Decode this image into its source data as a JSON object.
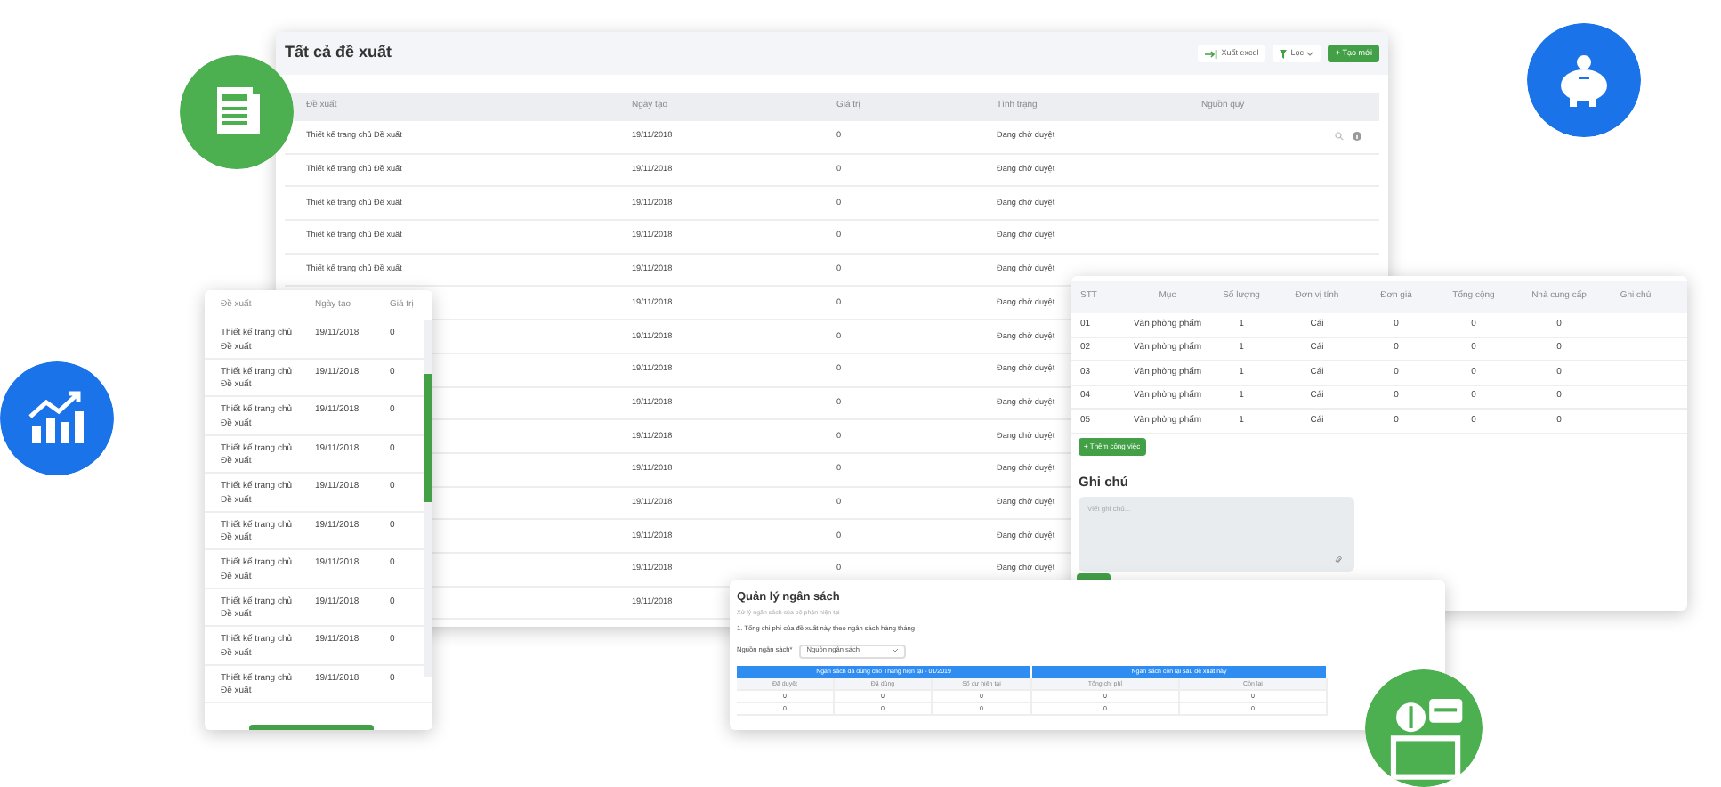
{
  "main_panel": {
    "title": "Tất cả đề xuất",
    "buttons": [
      {
        "kind": "export",
        "label": "Xuất excel"
      },
      {
        "kind": "filter",
        "label": "Lọc"
      },
      {
        "kind": "create",
        "label": "+ Tạo mới"
      }
    ],
    "columns": [
      "Đề xuất",
      "Ngày tạo",
      "Giá trị",
      "Tình trạng",
      "Nguồn quỹ"
    ],
    "rows": [
      {
        "title": "Thiết kế trang chủ Đề xuất",
        "date": "19/11/2018",
        "value": "0",
        "status": "Đang chờ duyệt",
        "actions": true
      },
      {
        "title": "Thiết kế trang chủ Đề xuất",
        "date": "19/11/2018",
        "value": "0",
        "status": "Đang chờ duyệt",
        "actions": false
      },
      {
        "title": "Thiết kế trang chủ Đề xuất",
        "date": "19/11/2018",
        "value": "0",
        "status": "Đang chờ duyệt",
        "actions": false
      },
      {
        "title": "Thiết kế trang chủ Đề xuất",
        "date": "19/11/2018",
        "value": "0",
        "status": "Đang chờ duyệt",
        "actions": false
      },
      {
        "title": "Thiết kế trang chủ Đề xuất",
        "date": "19/11/2018",
        "value": "0",
        "status": "Đang chờ duyệt",
        "actions": false
      },
      {
        "date": "19/11/2018",
        "value": "0",
        "status": "Đang chờ duyệt"
      },
      {
        "date": "19/11/2018",
        "value": "0",
        "status": "Đang chờ duyệt"
      },
      {
        "date": "19/11/2018",
        "value": "0",
        "status": "Đang chờ duyệt"
      },
      {
        "date": "19/11/2018",
        "value": "0",
        "status": "Đang chờ duyệt"
      },
      {
        "date": "19/11/2018",
        "value": "0",
        "status": "Đang chờ duyệt"
      },
      {
        "date": "19/11/2018",
        "value": "0",
        "status": "Đang chờ duyệt"
      },
      {
        "date": "19/11/2018",
        "value": "0",
        "status": "Đang chờ duyệt"
      },
      {
        "date": "19/11/2018",
        "value": "0",
        "status": "Đang chờ duyệt"
      },
      {
        "date": "19/11/2018",
        "value": "0",
        "status": "Đang chờ duyệt"
      },
      {
        "date": "19/11/2018"
      }
    ]
  },
  "list_panel": {
    "columns": [
      "Đề xuất",
      "Ngày tạo",
      "Giá trị"
    ],
    "rows": [
      {
        "title": "Thiết kế trang chủ Đề xuất",
        "date": "19/11/2018",
        "value": "0"
      },
      {
        "title": "Thiết kế trang chủ Đề xuất",
        "date": "19/11/2018",
        "value": "0"
      },
      {
        "title": "Thiết kế trang chủ Đề xuất",
        "date": "19/11/2018",
        "value": "0"
      },
      {
        "title": "Thiết kế trang chủ Đề xuất",
        "date": "19/11/2018",
        "value": "0"
      },
      {
        "title": "Thiết kế trang chủ Đề xuất",
        "date": "19/11/2018",
        "value": "0"
      },
      {
        "title": "Thiết kế trang chủ Đề xuất",
        "date": "19/11/2018",
        "value": "0"
      },
      {
        "title": "Thiết kế trang chủ Đề xuất",
        "date": "19/11/2018",
        "value": "0"
      },
      {
        "title": "Thiết kế trang chủ Đề xuất",
        "date": "19/11/2018",
        "value": "0"
      },
      {
        "title": "Thiết kế trang chủ Đề xuất",
        "date": "19/11/2018",
        "value": "0"
      },
      {
        "title": "Thiết kế trang chủ Đề xuất",
        "date": "19/11/2018",
        "value": "0"
      }
    ]
  },
  "items_panel": {
    "columns": [
      "STT",
      "Mục",
      "Số lượng",
      "Đơn vị tính",
      "Đơn giá",
      "Tổng cộng",
      "Nhà cung cấp",
      "Ghi chú"
    ],
    "rows": [
      [
        "01",
        "Văn phòng phẩm",
        "1",
        "Cái",
        "0",
        "0",
        "0"
      ],
      [
        "02",
        "Văn phòng phẩm",
        "1",
        "Cái",
        "0",
        "0",
        "0"
      ],
      [
        "03",
        "Văn phòng phẩm",
        "1",
        "Cái",
        "0",
        "0",
        "0"
      ],
      [
        "04",
        "Văn phòng phẩm",
        "1",
        "Cái",
        "0",
        "0",
        "0"
      ],
      [
        "05",
        "Văn phòng phẩm",
        "1",
        "Cái",
        "0",
        "0",
        "0"
      ]
    ],
    "add_button": "+ Thêm công việc",
    "notes_heading": "Ghi chú",
    "notes": {
      "placeholder": "Viết ghi chú..."
    }
  },
  "budget_panel": {
    "title": "Quản lý ngân sách",
    "subtitle": "Xử lý ngân sách của bộ phận hiện tại",
    "section": "1. Tổng chi phí của đề xuất này theo ngân sách hàng tháng",
    "source_label": "Nguồn ngân sách*",
    "source_value": "Nguồn ngân sách",
    "groups": [
      {
        "label": "Ngân sách đã dùng cho Tháng hiện tại - 01/2019",
        "columns": [
          "Đã duyệt",
          "Đã dùng",
          "Số dư hiện tại"
        ]
      },
      {
        "label": "Ngân sách còn lại sau đề xuất này",
        "columns": [
          "Tổng chi phí",
          "Còn lại"
        ]
      }
    ],
    "rows": [
      [
        "0",
        "0",
        "0",
        "0",
        "0"
      ],
      [
        "0",
        "0",
        "0",
        "0",
        "0"
      ]
    ]
  },
  "badges": [
    {
      "kind": "document",
      "color": "#4caf50"
    },
    {
      "kind": "piggy",
      "color": "#1a73e8"
    },
    {
      "kind": "chart",
      "color": "#1a73e8"
    },
    {
      "kind": "money",
      "color": "#4caf50"
    }
  ]
}
